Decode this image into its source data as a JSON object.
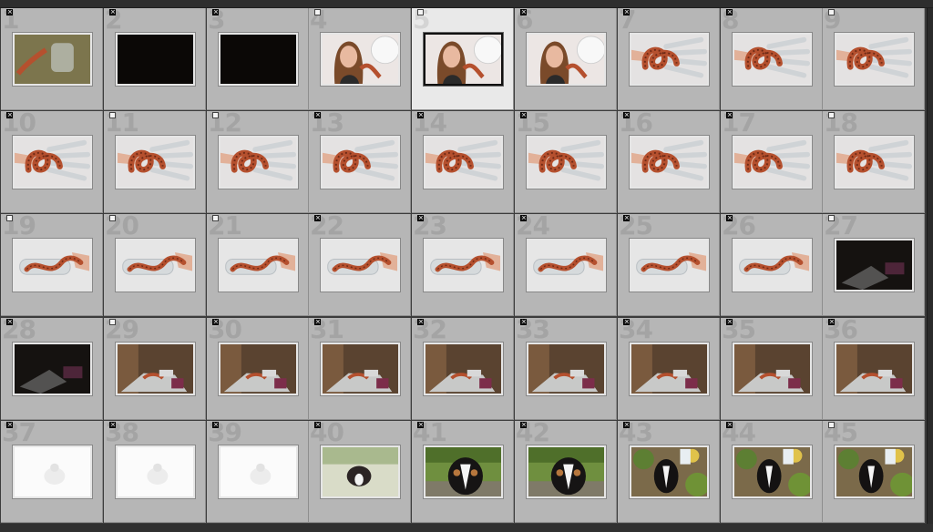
{
  "grid": {
    "selected_index": 4,
    "cells": [
      {
        "number": "1",
        "flag": "rejected",
        "scene": "snake-floor"
      },
      {
        "number": "2",
        "flag": "rejected",
        "scene": "dark"
      },
      {
        "number": "3",
        "flag": "rejected",
        "scene": "dark"
      },
      {
        "number": "4",
        "flag": "unflagged",
        "scene": "girl-snake"
      },
      {
        "number": "5",
        "flag": "unflagged",
        "scene": "girl-snake"
      },
      {
        "number": "6",
        "flag": "rejected",
        "scene": "girl-snake"
      },
      {
        "number": "7",
        "flag": "rejected",
        "scene": "snake-hand"
      },
      {
        "number": "8",
        "flag": "rejected",
        "scene": "snake-hand"
      },
      {
        "number": "9",
        "flag": "unflagged",
        "scene": "snake-hand"
      },
      {
        "number": "10",
        "flag": "rejected",
        "scene": "snake-hand"
      },
      {
        "number": "11",
        "flag": "unflagged",
        "scene": "snake-hand"
      },
      {
        "number": "12",
        "flag": "unflagged",
        "scene": "snake-hand"
      },
      {
        "number": "13",
        "flag": "rejected",
        "scene": "snake-hand"
      },
      {
        "number": "14",
        "flag": "rejected",
        "scene": "snake-hand"
      },
      {
        "number": "15",
        "flag": "rejected",
        "scene": "snake-hand"
      },
      {
        "number": "16",
        "flag": "rejected",
        "scene": "snake-hand"
      },
      {
        "number": "17",
        "flag": "rejected",
        "scene": "snake-hand"
      },
      {
        "number": "18",
        "flag": "unflagged",
        "scene": "snake-hand"
      },
      {
        "number": "19",
        "flag": "unflagged",
        "scene": "snake-bottle"
      },
      {
        "number": "20",
        "flag": "unflagged",
        "scene": "snake-bottle"
      },
      {
        "number": "21",
        "flag": "unflagged",
        "scene": "snake-bottle"
      },
      {
        "number": "22",
        "flag": "rejected",
        "scene": "snake-bottle"
      },
      {
        "number": "23",
        "flag": "rejected",
        "scene": "snake-bottle"
      },
      {
        "number": "24",
        "flag": "rejected",
        "scene": "snake-bottle"
      },
      {
        "number": "25",
        "flag": "rejected",
        "scene": "snake-bottle"
      },
      {
        "number": "26",
        "flag": "rejected",
        "scene": "snake-bottle"
      },
      {
        "number": "27",
        "flag": "unflagged",
        "scene": "dark-box"
      },
      {
        "number": "28",
        "flag": "rejected",
        "scene": "dark-box"
      },
      {
        "number": "29",
        "flag": "unflagged",
        "scene": "box"
      },
      {
        "number": "30",
        "flag": "rejected",
        "scene": "box"
      },
      {
        "number": "31",
        "flag": "rejected",
        "scene": "box"
      },
      {
        "number": "32",
        "flag": "rejected",
        "scene": "box"
      },
      {
        "number": "33",
        "flag": "rejected",
        "scene": "box"
      },
      {
        "number": "34",
        "flag": "rejected",
        "scene": "box"
      },
      {
        "number": "35",
        "flag": "rejected",
        "scene": "box"
      },
      {
        "number": "36",
        "flag": "rejected",
        "scene": "box"
      },
      {
        "number": "37",
        "flag": "rejected",
        "scene": "overexposed"
      },
      {
        "number": "38",
        "flag": "rejected",
        "scene": "overexposed"
      },
      {
        "number": "39",
        "flag": "rejected",
        "scene": "overexposed"
      },
      {
        "number": "40",
        "flag": "rejected",
        "scene": "dog-bright"
      },
      {
        "number": "41",
        "flag": "rejected",
        "scene": "dog"
      },
      {
        "number": "42",
        "flag": "rejected",
        "scene": "dog"
      },
      {
        "number": "43",
        "flag": "rejected",
        "scene": "dog-garden"
      },
      {
        "number": "44",
        "flag": "rejected",
        "scene": "dog-garden"
      },
      {
        "number": "45",
        "flag": "unflagged",
        "scene": "dog-garden"
      }
    ]
  }
}
